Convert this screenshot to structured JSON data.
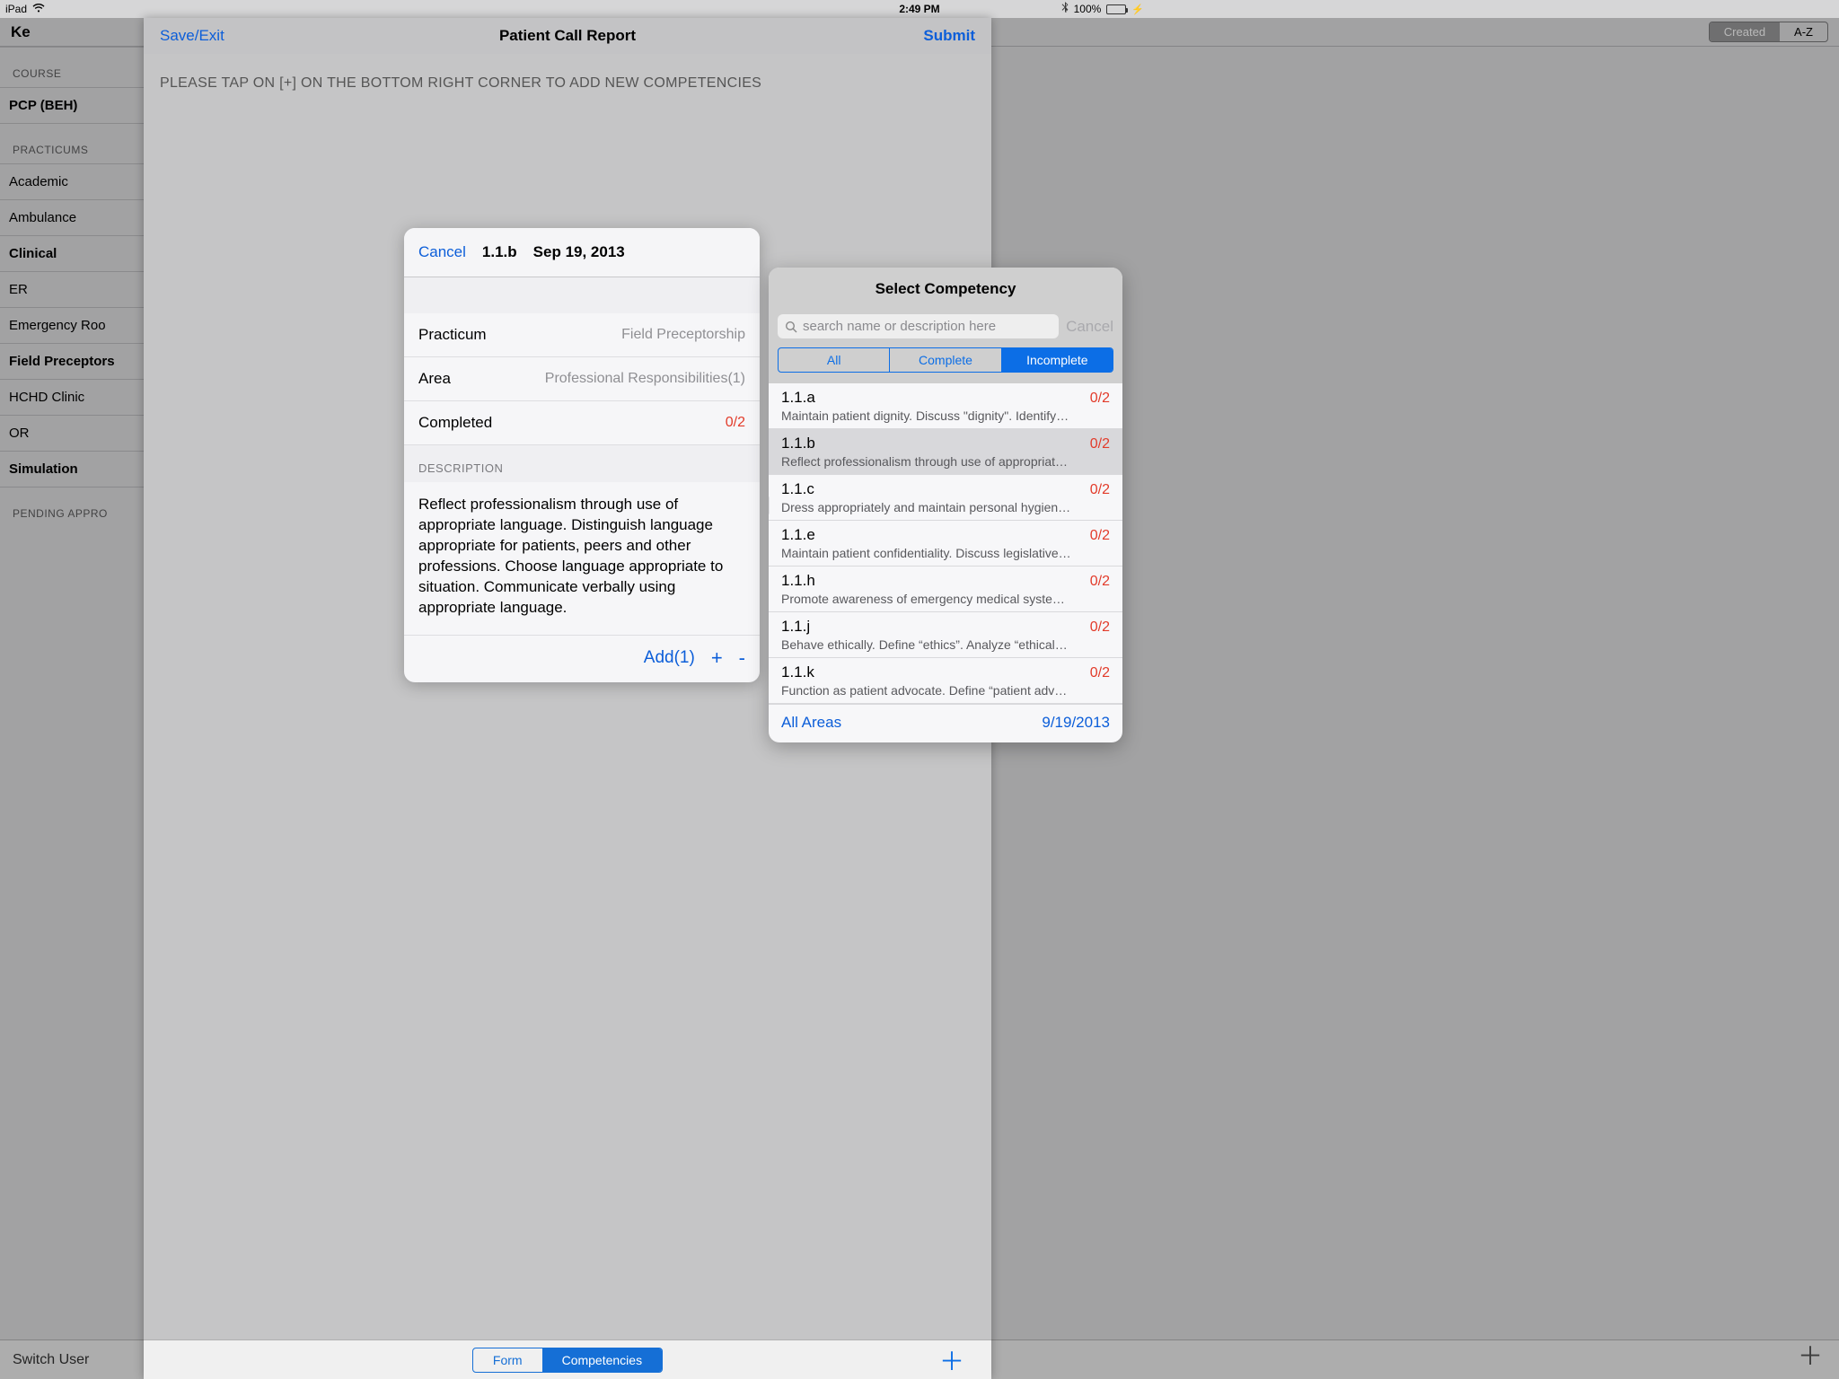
{
  "status": {
    "carrier": "iPad",
    "time": "2:49 PM",
    "battery": "100%"
  },
  "bg": {
    "title": "Ke",
    "seg": {
      "created": "Created",
      "az": "A-Z"
    },
    "sections": [
      {
        "label": "COURSE",
        "items": [
          {
            "t": "PCP (BEH)",
            "bold": true
          }
        ]
      },
      {
        "label": "PRACTICUMS",
        "items": [
          {
            "t": "Academic"
          },
          {
            "t": "Ambulance"
          },
          {
            "t": "Clinical",
            "bold": true
          },
          {
            "t": "ER"
          },
          {
            "t": "Emergency Roo"
          },
          {
            "t": "Field Preceptors",
            "bold": true
          },
          {
            "t": "HCHD Clinic"
          },
          {
            "t": "OR"
          },
          {
            "t": "Simulation",
            "bold": true
          }
        ]
      },
      {
        "label": "PENDING APPRO",
        "items": []
      }
    ],
    "footer": {
      "switch": "Switch User",
      "form": "Form",
      "comp": "Competencies"
    }
  },
  "sheet": {
    "save": "Save/Exit",
    "title": "Patient Call Report",
    "submit": "Submit",
    "hint": "PLEASE TAP ON [+] ON THE BOTTOM RIGHT CORNER TO ADD NEW COMPETENCIES"
  },
  "detail": {
    "cancel": "Cancel",
    "code": "1.1.b",
    "date": "Sep 19, 2013",
    "rows": [
      {
        "k": "Practicum",
        "v": "Field Preceptorship"
      },
      {
        "k": "Area",
        "v": "Professional Responsibilities(1)"
      },
      {
        "k": "Completed",
        "v": "0/2",
        "red": true
      }
    ],
    "descLabel": "DESCRIPTION",
    "desc": "Reflect professionalism through use of appropriate language.  Distinguish language appropriate for patients, peers and other professions.  Choose language appropriate to situation.  Communicate verbally using appropriate language.",
    "add": "Add(1)"
  },
  "sel": {
    "title": "Select Competency",
    "placeholder": "search name or description here",
    "cancel": "Cancel",
    "filters": [
      "All",
      "Complete",
      "Incomplete"
    ],
    "filterSel": 2,
    "items": [
      {
        "code": "1.1.a",
        "ratio": "0/2",
        "desc": "Maintain patient dignity. Discuss \"dignity\". Identify…"
      },
      {
        "code": "1.1.b",
        "ratio": "0/2",
        "desc": "Reflect professionalism through use of appropriat…",
        "selected": true
      },
      {
        "code": "1.1.c",
        "ratio": "0/2",
        "desc": "Dress appropriately and maintain personal hygien…"
      },
      {
        "code": "1.1.e",
        "ratio": "0/2",
        "desc": "Maintain patient confidentiality.  Discuss legislative…"
      },
      {
        "code": "1.1.h",
        "ratio": "0/2",
        "desc": "Promote awareness of emergency medical syste…"
      },
      {
        "code": "1.1.j",
        "ratio": "0/2",
        "desc": "Behave ethically.  Define “ethics”. Analyze “ethical…"
      },
      {
        "code": "1.1.k",
        "ratio": "0/2",
        "desc": "Function as patient advocate.  Define “patient adv…"
      }
    ],
    "footer": {
      "areas": "All Areas",
      "date": "9/19/2013"
    }
  }
}
